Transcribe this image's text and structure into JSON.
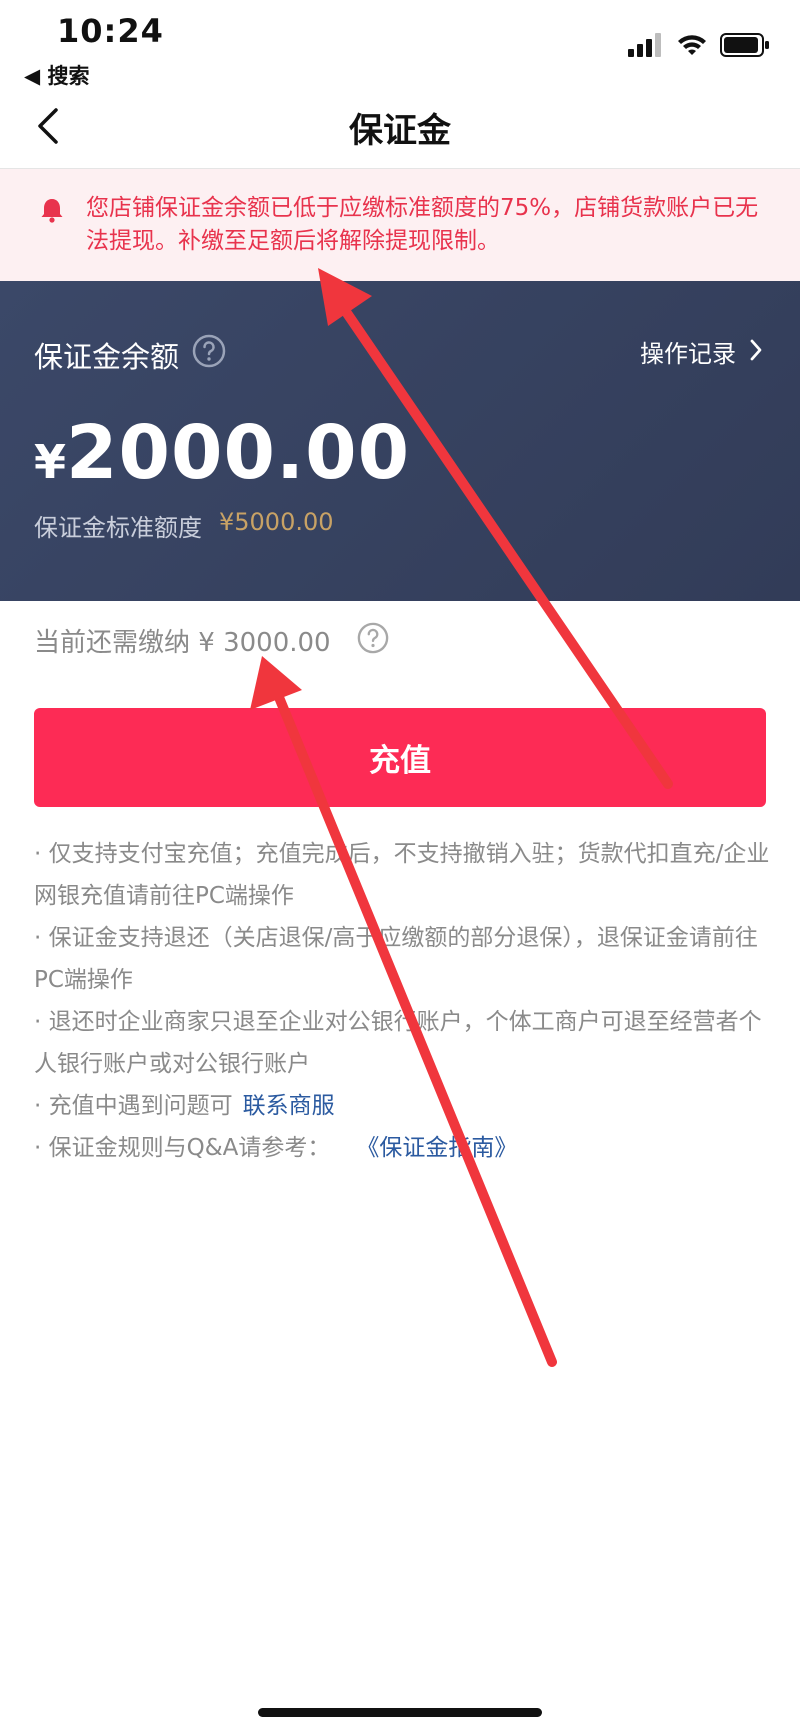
{
  "status_bar": {
    "time": "10:24",
    "back_app": "◀ 搜索"
  },
  "nav": {
    "title": "保证金"
  },
  "alert": {
    "text": "您店铺保证金余额已低于应缴标准额度的75%，店铺货款账户已无法提现。补缴至足额后将解除提现限制。"
  },
  "card": {
    "balance_label": "保证金余额",
    "records_label": "操作记录",
    "currency": "¥",
    "amount": "2000.00",
    "standard_label": "保证金标准额度",
    "standard_value": "¥5000.00"
  },
  "due": {
    "text": "当前还需缴纳 ¥ 3000.00"
  },
  "recharge_button": {
    "label": "充值"
  },
  "notes": {
    "line1": "· 仅支持支付宝充值；充值完成后，不支持撤销入驻；货款代扣直充/企业网银充值请前往PC端操作",
    "line2": "· 保证金支持退还（关店退保/高于应缴额的部分退保），退保证金请前往PC端操作",
    "line3": "· 退还时企业商家只退至企业对公银行账户，个体工商户可退至经营者个人银行账户或对公银行账户",
    "line4_prefix": "· 充值中遇到问题可",
    "line4_link": "联系商服",
    "line5_prefix": "· 保证金规则与Q&A请参考：",
    "line5_link": "《保证金指南》"
  },
  "colors": {
    "accent": "#fd2b55",
    "alert_text": "#e8334d",
    "alert_bg": "#fdf0f2",
    "card_bg": "#374362",
    "gold": "#c8a265",
    "link": "#2b5aa0",
    "annotation_arrow": "#f0363d"
  },
  "icons": [
    "signal-icon",
    "wifi-icon",
    "battery-icon",
    "back-chevron-icon",
    "bell-icon",
    "help-circle-icon",
    "chevron-right-icon"
  ]
}
